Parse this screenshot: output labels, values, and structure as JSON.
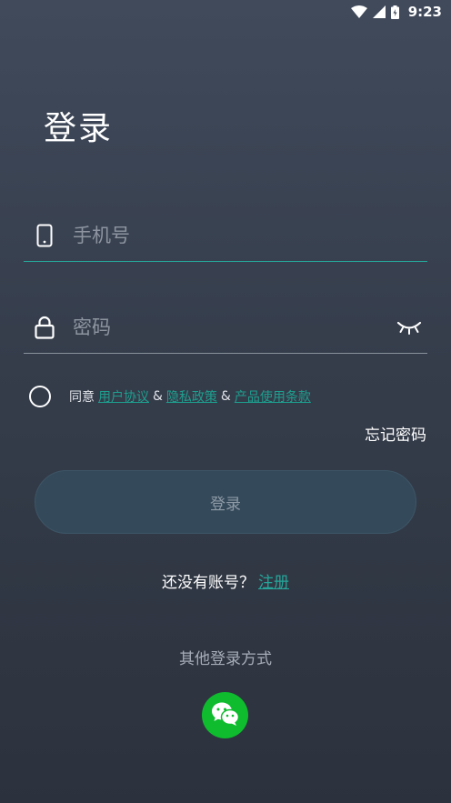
{
  "status_bar": {
    "time": "9:23",
    "icons": [
      "wifi-icon",
      "signal-icon",
      "battery-icon"
    ]
  },
  "title": "登录",
  "phone": {
    "placeholder": "手机号",
    "value": "",
    "icon": "phone-icon"
  },
  "password": {
    "placeholder": "密码",
    "value": "",
    "icon": "lock-icon",
    "toggle_icon": "eye-closed-icon"
  },
  "agreement": {
    "prefix": "同意",
    "user_agreement": "用户协议",
    "privacy_policy": "隐私政策",
    "product_terms": "产品使用条款",
    "separator": "&"
  },
  "forgot_password": "忘记密码",
  "login_button": "登录",
  "register": {
    "prompt": "还没有账号？",
    "link": "注册"
  },
  "other_login": {
    "title": "其他登录方式",
    "wechat_icon": "wechat-icon"
  },
  "colors": {
    "accent": "#26a69a",
    "link": "#1e9e8e",
    "wechat": "#0ebc2e",
    "button_bg": "#344a5b",
    "button_text": "#8f9aa6"
  }
}
